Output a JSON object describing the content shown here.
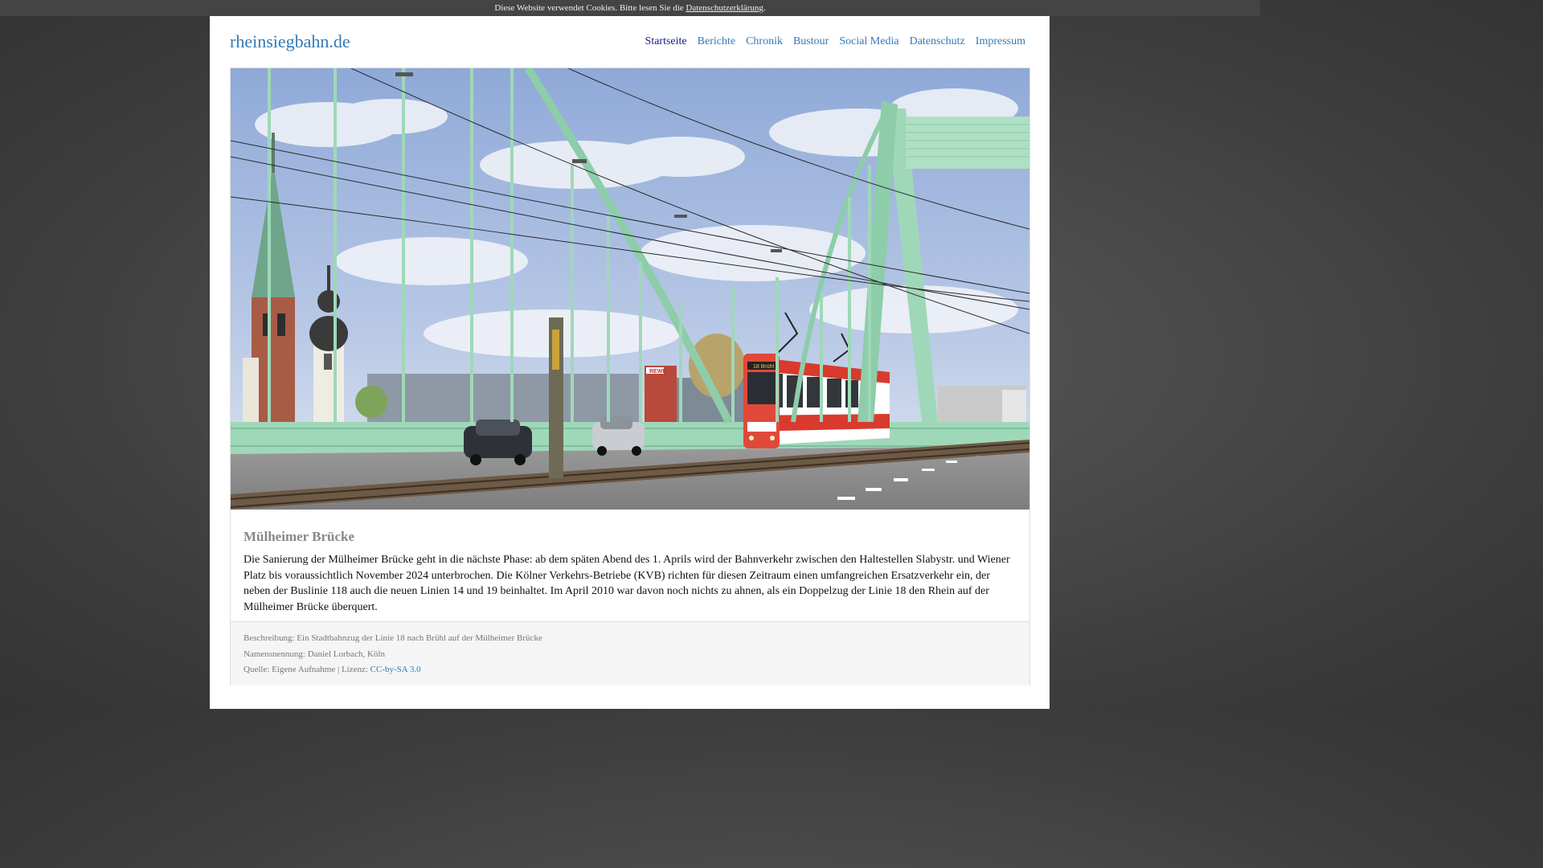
{
  "cookie": {
    "text": "Diese Website verwendet Cookies. Bitte lesen Sie die",
    "link": "Datenschutzerklärung",
    "suffix": "."
  },
  "header": {
    "site_title": "rheinsiegbahn.de",
    "nav": [
      {
        "label": "Startseite",
        "active": true
      },
      {
        "label": "Berichte"
      },
      {
        "label": "Chronik"
      },
      {
        "label": "Bustour"
      },
      {
        "label": "Social Media"
      },
      {
        "label": "Datenschutz"
      },
      {
        "label": "Impressum"
      }
    ]
  },
  "article": {
    "title": "Mülheimer Brücke",
    "text": "Die Sanierung der Mülheimer Brücke geht in die nächste Phase: ab dem späten Abend des 1. Aprils wird der Bahnverkehr zwischen den Haltestellen Slabystr. und Wiener Platz bis voraussichtlich November 2024 unterbrochen. Die Kölner Verkehrs-Betriebe (KVB) richten für diesen Zeitraum einen umfangreichen Ersatzverkehr ein, der neben der Buslinie 118 auch die neuen Linien 14 und 19 beinhaltet. Im April 2010 war davon noch nichts zu ahnen, als ein Doppelzug der Linie 18 den Rhein auf der Mülheimer Brücke überquert."
  },
  "photo": {
    "sign_text": "18 Brühl",
    "billboard_text": "REWE"
  },
  "footer": {
    "description": "Beschreibung: Ein Stadtbahnzug der Linie 18 nach Brühl auf der Mülheimer Brücke",
    "attribution": "Namensnennung: Daniel Lorbach, Köln",
    "source": "Quelle: Eigene Aufnahme | Lizenz:",
    "license_link": "CC-by-SA 3.0"
  },
  "colors": {
    "link": "#337ab7",
    "bridge": "#9fd8b8",
    "tram_red": "#d93a2e"
  }
}
